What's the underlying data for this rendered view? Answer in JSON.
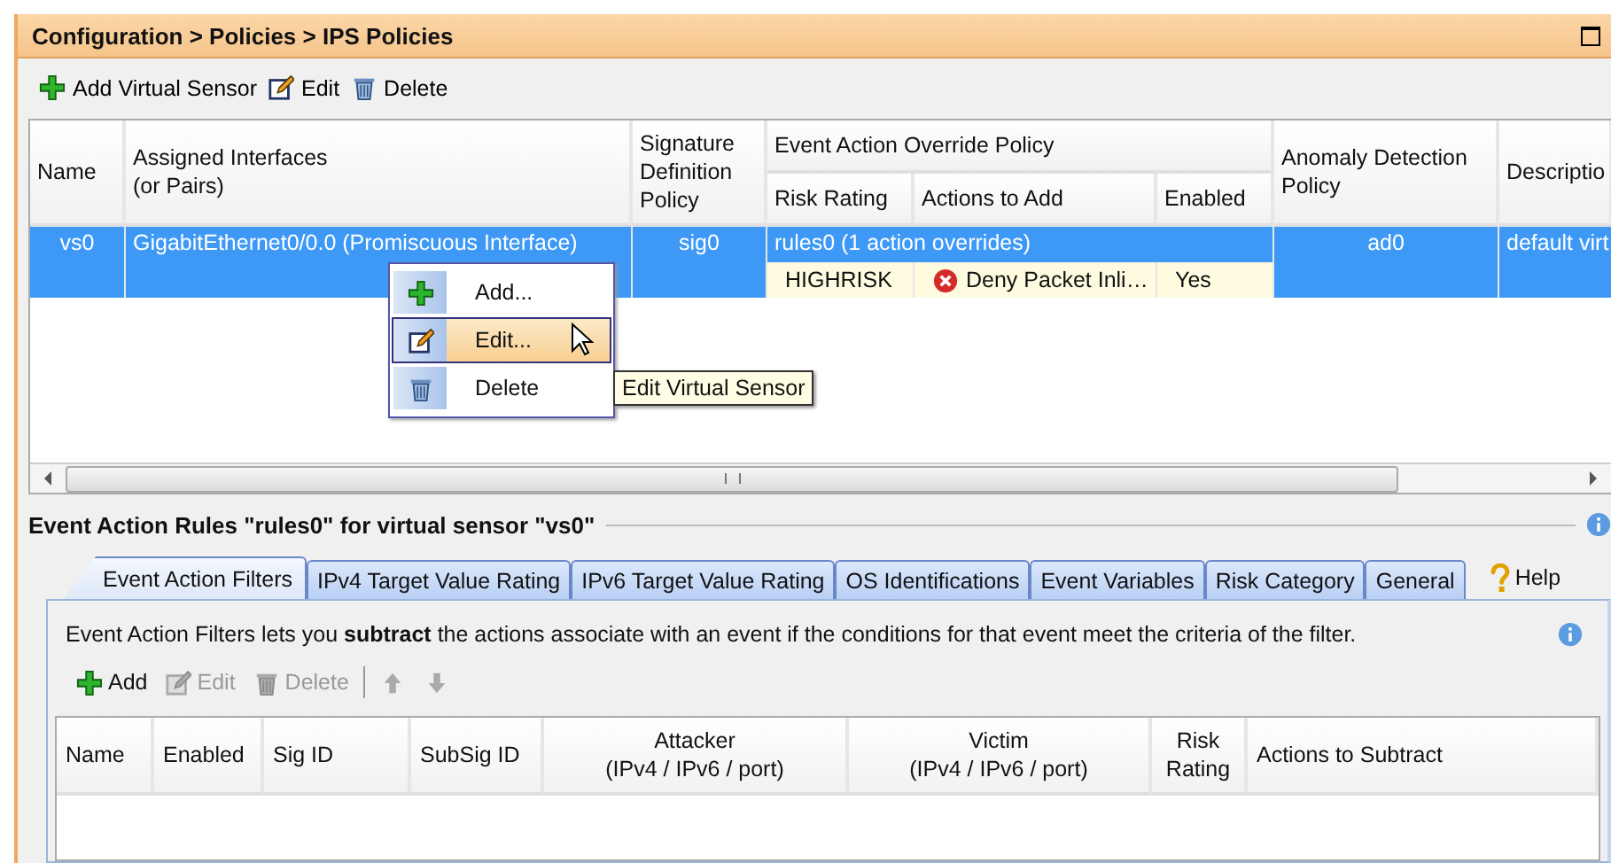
{
  "window": {
    "title": "Configuration > Policies > IPS Policies"
  },
  "toolbar": [
    {
      "label": "Add Virtual Sensor",
      "kind": "add"
    },
    {
      "label": "Edit",
      "kind": "edit"
    },
    {
      "label": "Delete",
      "kind": "delete"
    }
  ],
  "sensors_table": {
    "columns": [
      {
        "label": "Name"
      },
      {
        "label": "Assigned Interfaces\n(or Pairs)"
      },
      {
        "label": "Signature\nDefinition\nPolicy"
      },
      {
        "label": "Event Action Override Policy",
        "children": [
          {
            "label": "Risk Rating"
          },
          {
            "label": "Actions to Add"
          },
          {
            "label": "Enabled"
          }
        ]
      },
      {
        "label": "Anomaly Detection\nPolicy"
      },
      {
        "label": "Descriptio"
      }
    ],
    "rows": [
      {
        "selected": true,
        "cells": [
          "vs0",
          "GigabitEthernet0/0.0 (Promiscuous Interface)",
          "sig0",
          "rules0 (1 action overrides)",
          "ad0",
          "default virt"
        ],
        "overrides": [
          [
            "HIGHRISK",
            "Deny Packet Inli…",
            "Yes"
          ]
        ]
      }
    ]
  },
  "context_menu": {
    "items": [
      {
        "label": "Add...",
        "kind": "add",
        "selected": false
      },
      {
        "label": "Edit...",
        "kind": "edit",
        "selected": true
      },
      {
        "label": "Delete",
        "kind": "delete",
        "selected": false
      }
    ]
  },
  "tooltip": "Edit Virtual Sensor",
  "rules_section": {
    "title": "Event Action Rules \"rules0\" for virtual sensor \"vs0\"",
    "tabs": [
      {
        "label": "Event Action Filters",
        "selected": true
      },
      {
        "label": "IPv4 Target Value Rating",
        "selected": false
      },
      {
        "label": "IPv6 Target Value Rating",
        "selected": false
      },
      {
        "label": "OS Identifications",
        "selected": false
      },
      {
        "label": "Event Variables",
        "selected": false
      },
      {
        "label": "Risk Category",
        "selected": false
      },
      {
        "label": "General",
        "selected": false
      }
    ],
    "help": "Help",
    "description": "Event Action Filters lets you **subtract** the actions associate with an event if the conditions for that event meet the criteria of the filter.",
    "toolbar": [
      {
        "label": "Add",
        "kind": "add",
        "disabled": false
      },
      {
        "label": "Edit",
        "kind": "edit",
        "disabled": true
      },
      {
        "label": "Delete",
        "kind": "delete",
        "disabled": true
      },
      {
        "kind": "up",
        "disabled": true
      },
      {
        "kind": "down",
        "disabled": true
      }
    ],
    "filters_table": {
      "columns": [
        "Name",
        "Enabled",
        "Sig ID",
        "SubSig ID",
        "Attacker\n(IPv4 / IPv6 / port)",
        "Victim\n(IPv4 / IPv6 / port)",
        "Risk\nRating",
        "Actions to Subtract"
      ]
    }
  }
}
